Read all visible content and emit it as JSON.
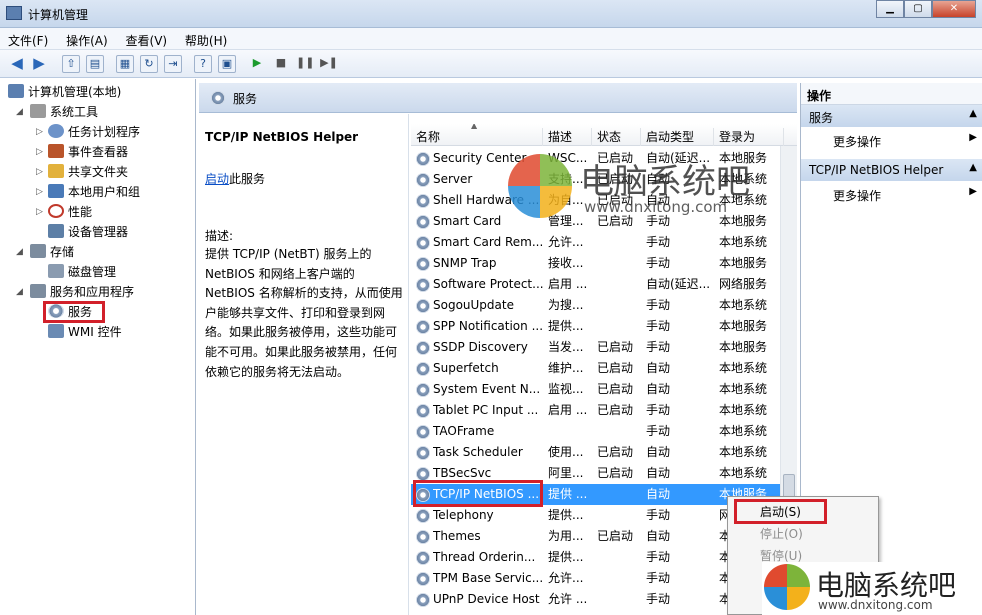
{
  "window": {
    "title": "计算机管理"
  },
  "menu": [
    "文件(F)",
    "操作(A)",
    "查看(V)",
    "帮助(H)"
  ],
  "tree": [
    {
      "label": "计算机管理(本地)",
      "icon": "computer-icon",
      "color": "#5b7fb0"
    },
    {
      "label": "系统工具",
      "icon": "tools-icon",
      "color": "#8b8b8b"
    },
    {
      "label": "任务计划程序",
      "icon": "clock-icon",
      "color": "#6d93c9"
    },
    {
      "label": "事件查看器",
      "icon": "event-viewer-icon",
      "color": "#b9542a"
    },
    {
      "label": "共享文件夹",
      "icon": "shared-folder-icon",
      "color": "#e2b13c"
    },
    {
      "label": "本地用户和组",
      "icon": "users-icon",
      "color": "#4a7ab8"
    },
    {
      "label": "性能",
      "icon": "performance-icon",
      "color": "#c0392b"
    },
    {
      "label": "设备管理器",
      "icon": "device-manager-icon",
      "color": "#5d7fa6"
    },
    {
      "label": "存储",
      "icon": "storage-icon",
      "color": "#7c8c9e"
    },
    {
      "label": "磁盘管理",
      "icon": "disk-icon",
      "color": "#8a9bb0"
    },
    {
      "label": "服务和应用程序",
      "icon": "services-apps-icon",
      "color": "#7c8c9e"
    },
    {
      "label": "服务",
      "icon": "gear-icon",
      "color": "#8da3bf"
    },
    {
      "label": "WMI 控件",
      "icon": "wmi-icon",
      "color": "#6a8ab3"
    }
  ],
  "center": {
    "title": "服务"
  },
  "desc": {
    "service_name": "TCP/IP NetBIOS Helper",
    "start_link": "启动",
    "start_suffix": "此服务",
    "label": "描述:",
    "text": "提供 TCP/IP (NetBT) 服务上的 NetBIOS 和网络上客户端的 NetBIOS 名称解析的支持，从而使用户能够共享文件、打印和登录到网络。如果此服务被停用，这些功能可能不可用。如果此服务被禁用，任何依赖它的服务将无法启动。"
  },
  "columns": [
    "名称",
    "描述",
    "状态",
    "启动类型",
    "登录为"
  ],
  "services": [
    {
      "name": "Security Center",
      "desc": "WSC...",
      "status": "已启动",
      "start": "自动(延迟...",
      "logon": "本地服务"
    },
    {
      "name": "Server",
      "desc": "支持...",
      "status": "已启动",
      "start": "自动",
      "logon": "本地系统"
    },
    {
      "name": "Shell Hardware ...",
      "desc": "为自...",
      "status": "已启动",
      "start": "自动",
      "logon": "本地系统"
    },
    {
      "name": "Smart Card",
      "desc": "管理...",
      "status": "已启动",
      "start": "手动",
      "logon": "本地服务"
    },
    {
      "name": "Smart Card Rem...",
      "desc": "允许...",
      "status": "",
      "start": "手动",
      "logon": "本地系统"
    },
    {
      "name": "SNMP Trap",
      "desc": "接收...",
      "status": "",
      "start": "手动",
      "logon": "本地服务"
    },
    {
      "name": "Software Protect...",
      "desc": "启用 ...",
      "status": "",
      "start": "自动(延迟...",
      "logon": "网络服务"
    },
    {
      "name": "SogouUpdate",
      "desc": "为搜...",
      "status": "",
      "start": "手动",
      "logon": "本地系统"
    },
    {
      "name": "SPP Notification ...",
      "desc": "提供...",
      "status": "",
      "start": "手动",
      "logon": "本地服务"
    },
    {
      "name": "SSDP Discovery",
      "desc": "当发...",
      "status": "已启动",
      "start": "手动",
      "logon": "本地服务"
    },
    {
      "name": "Superfetch",
      "desc": "维护...",
      "status": "已启动",
      "start": "自动",
      "logon": "本地系统"
    },
    {
      "name": "System Event N...",
      "desc": "监视...",
      "status": "已启动",
      "start": "自动",
      "logon": "本地系统"
    },
    {
      "name": "Tablet PC Input ...",
      "desc": "启用 ...",
      "status": "已启动",
      "start": "手动",
      "logon": "本地系统"
    },
    {
      "name": "TAOFrame",
      "desc": "",
      "status": "",
      "start": "手动",
      "logon": "本地系统"
    },
    {
      "name": "Task Scheduler",
      "desc": "使用...",
      "status": "已启动",
      "start": "自动",
      "logon": "本地系统"
    },
    {
      "name": "TBSecSvc",
      "desc": "阿里...",
      "status": "已启动",
      "start": "自动",
      "logon": "本地系统"
    },
    {
      "name": "TCP/IP NetBIOS ...",
      "desc": "提供 ...",
      "status": "",
      "start": "自动",
      "logon": "本地服务"
    },
    {
      "name": "Telephony",
      "desc": "提供...",
      "status": "",
      "start": "手动",
      "logon": "网"
    },
    {
      "name": "Themes",
      "desc": "为用...",
      "status": "已启动",
      "start": "自动",
      "logon": "本"
    },
    {
      "name": "Thread Orderin...",
      "desc": "提供...",
      "status": "",
      "start": "手动",
      "logon": "本"
    },
    {
      "name": "TPM Base Servic...",
      "desc": "允许...",
      "status": "",
      "start": "手动",
      "logon": "本"
    },
    {
      "name": "UPnP Device Host",
      "desc": "允许 ...",
      "status": "",
      "start": "手动",
      "logon": "本"
    }
  ],
  "selected_index": 16,
  "actions": {
    "title": "操作",
    "section1": "服务",
    "section2": "TCP/IP NetBIOS Helper",
    "more": "更多操作"
  },
  "context_menu": [
    {
      "label": "启动(S)",
      "enabled": true
    },
    {
      "label": "停止(O)",
      "enabled": false
    },
    {
      "label": "暂停(U)",
      "enabled": false
    }
  ],
  "watermark": {
    "brand": "电脑系统吧",
    "url": "www.dnxitong.com"
  },
  "colors": {
    "selection": "#3399ff",
    "highlight_box": "#d2202a",
    "link": "#0a4ec6"
  }
}
